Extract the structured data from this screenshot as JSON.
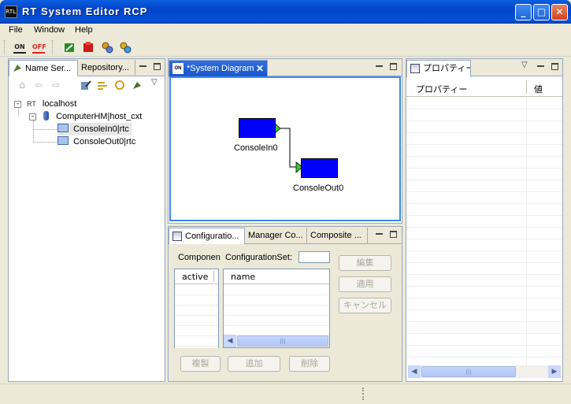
{
  "window": {
    "title": "RT System Editor RCP",
    "icon_label": "RTL"
  },
  "menu": [
    "File",
    "Window",
    "Help"
  ],
  "toolbar": {
    "on_label": "ON",
    "off_label": "OFF"
  },
  "left_panel": {
    "tabs": [
      "Name Ser...",
      "Repository..."
    ],
    "tree": [
      {
        "label": "localhost",
        "prefix": "RT"
      },
      {
        "label": "ComputerHM|host_cxt"
      },
      {
        "label": "ConsoleIn0|rtc"
      },
      {
        "label": "ConsoleOut0|rtc"
      }
    ]
  },
  "editor": {
    "tab": "*System Diagram",
    "components": [
      {
        "label": "ConsoleIn0"
      },
      {
        "label": "ConsoleOut0"
      }
    ]
  },
  "bottom": {
    "tabs": [
      "Configuratio...",
      "Manager Co...",
      "Composite ..."
    ],
    "component_label": "Componen",
    "config_set_label": "ConfigurationSet:",
    "config_set_value": "",
    "columns_left": [
      "active"
    ],
    "columns_right": [
      "name"
    ],
    "buttons_right": [
      "編集",
      "適用",
      "キャンセル"
    ],
    "buttons_bottom": [
      "複製",
      "追加",
      "削除"
    ]
  },
  "properties": {
    "tab": "プロパティー",
    "columns": [
      "プロパティー",
      "値"
    ]
  },
  "colors": {
    "node": "#0000ff",
    "port": "#33cc33",
    "focus": "#3c8ce8"
  }
}
